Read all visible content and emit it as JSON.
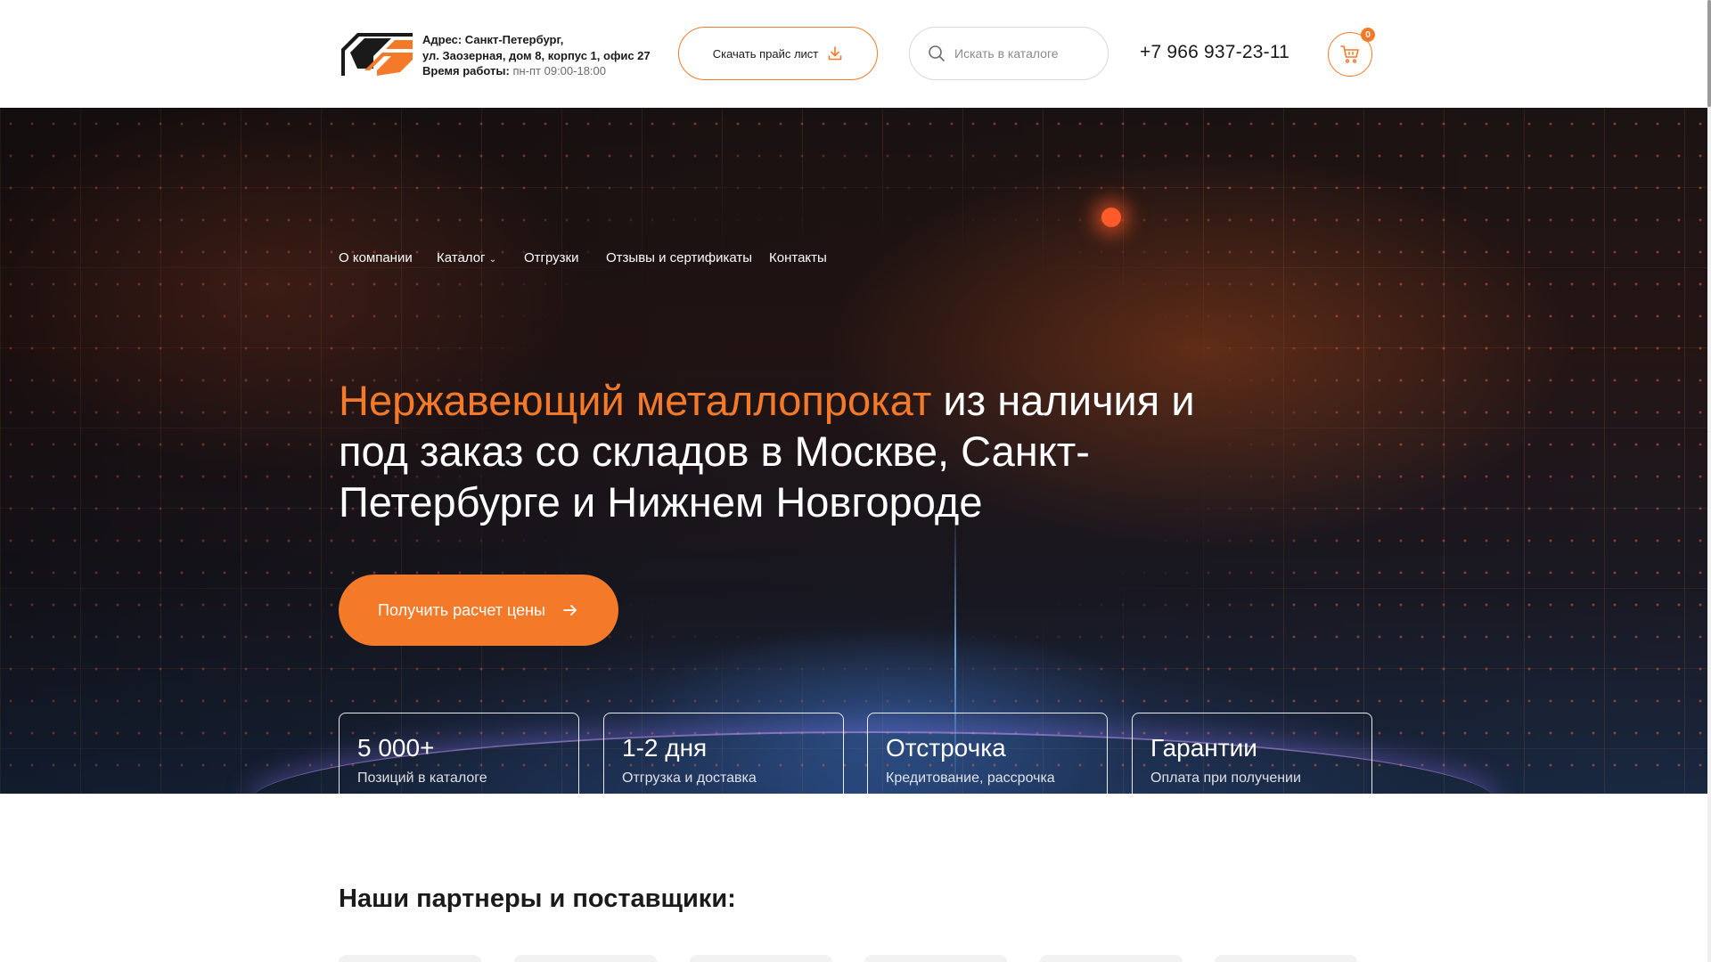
{
  "header": {
    "address_label": "Адрес: Санкт-Петербург,",
    "address_line2": "ул. Заозерная, дом 8, корпус 1, офис 27",
    "hours_label": "Время работы:",
    "hours_value": "пн-пт 09:00-18:00",
    "price_button": "Скачать прайс лист",
    "search_placeholder": "Искать в каталоге",
    "phone": "+7 966 937-23-11",
    "cart_count": "0"
  },
  "nav": {
    "items": [
      "О компании",
      "Каталог",
      "Отгрузки",
      "Отзывы и сертификаты",
      "Контакты"
    ]
  },
  "hero": {
    "title_accent": "Нержавеющий металлопрокат",
    "title_rest": " из наличия и под заказ со складов в Москве, Санкт-Петербурге и Нижнем Новгороде",
    "cta": "Получить расчет цены",
    "stats": [
      {
        "value": "5 000+",
        "label": "Позиций в каталоге"
      },
      {
        "value": "1-2 дня",
        "label": "Отгрузка и доставка"
      },
      {
        "value": "Отстрочка",
        "label": "Кредитование, рассрочка"
      },
      {
        "value": "Гарантии",
        "label": "Оплата при получении"
      }
    ]
  },
  "partners": {
    "title": "Наши партнеры и поставщики:"
  },
  "colors": {
    "accent": "#f47a2a",
    "text": "#1a1a1a"
  },
  "icons": [
    "logo-icon",
    "download-icon",
    "search-icon",
    "cart-icon",
    "chevron-down-icon",
    "arrow-right-icon"
  ]
}
